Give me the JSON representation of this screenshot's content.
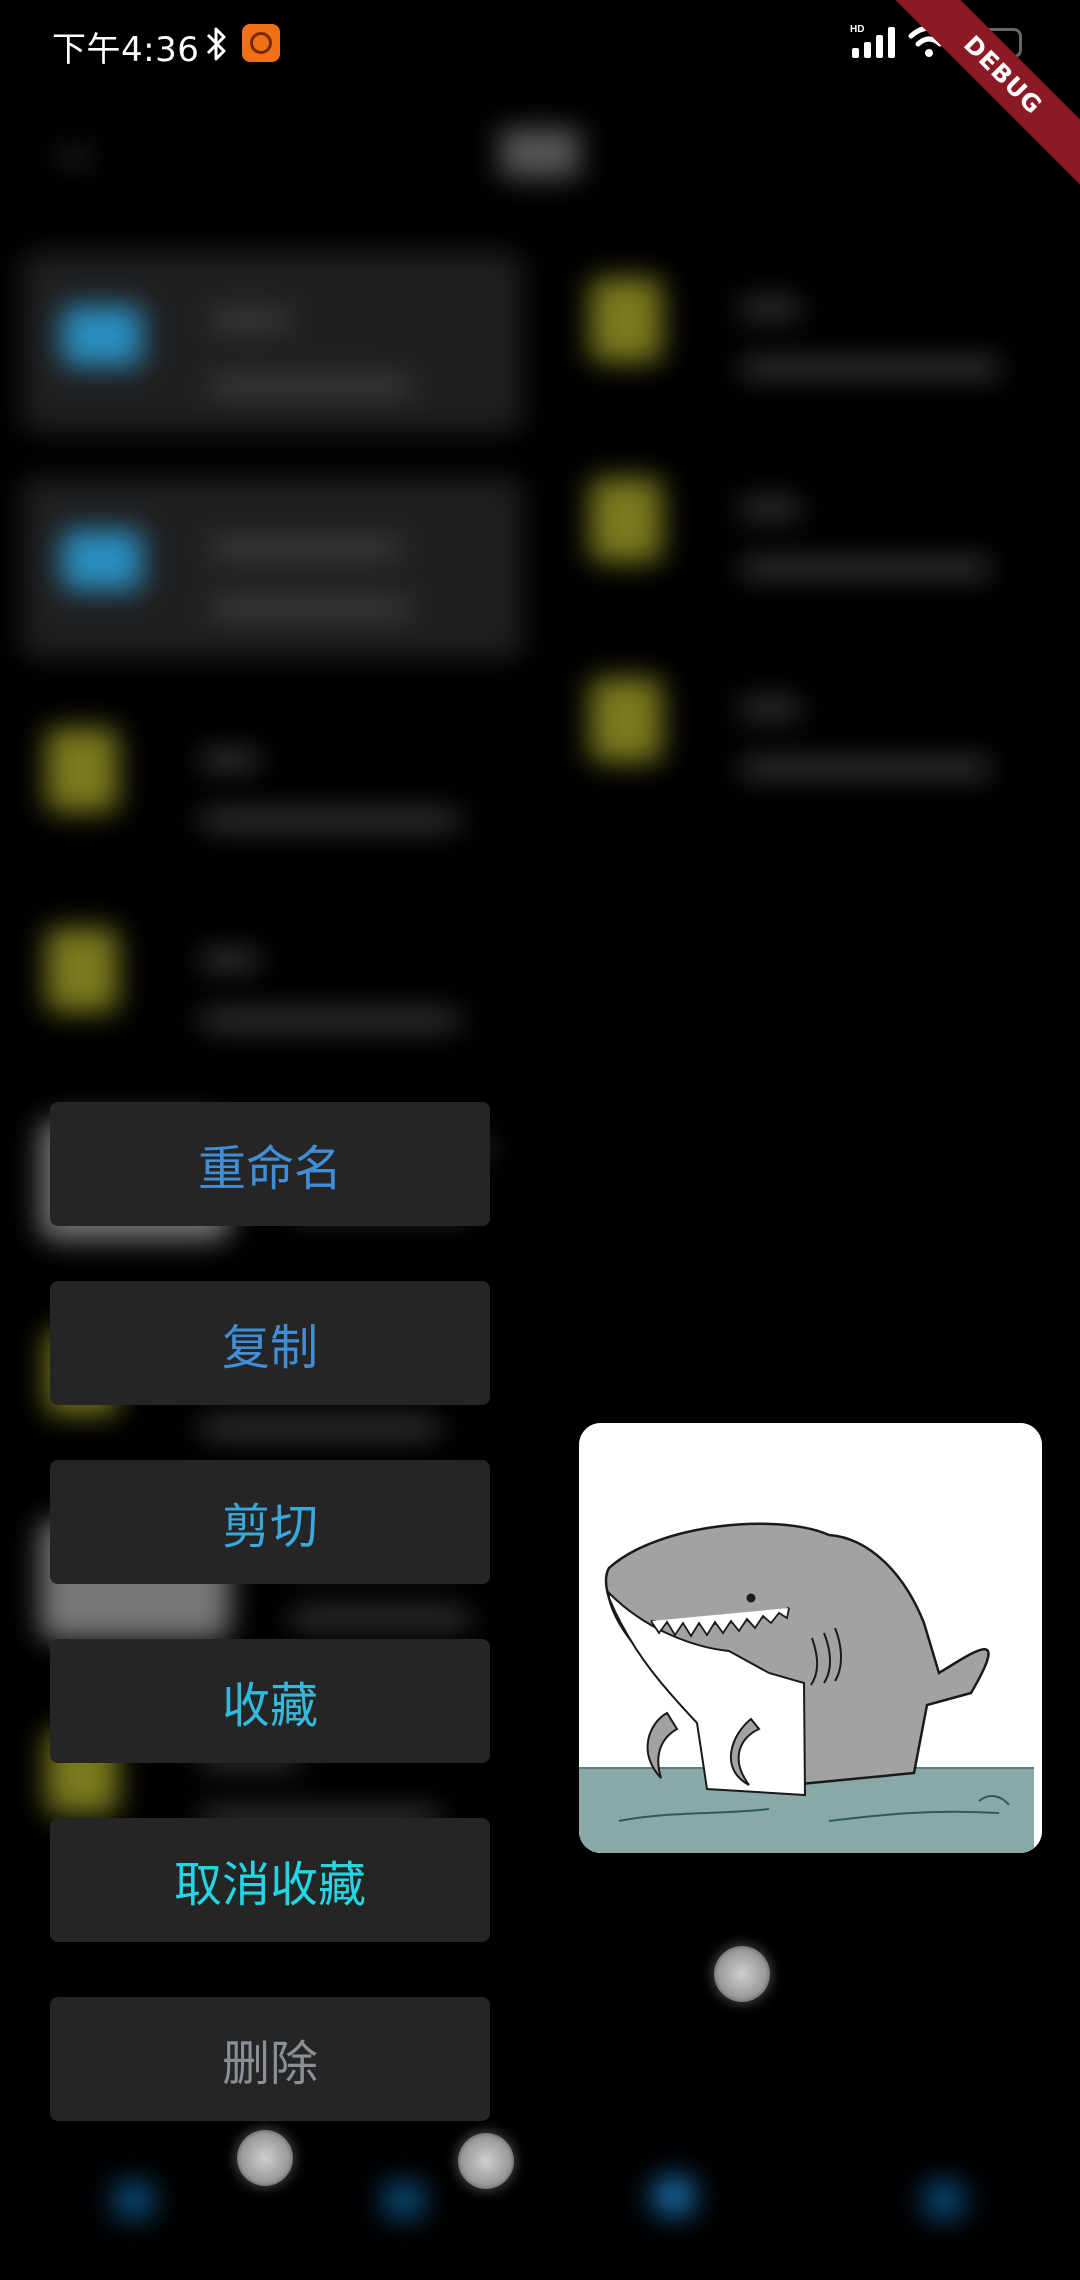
{
  "status_bar": {
    "time": "下午4:36",
    "network_label": "HD",
    "icons": [
      "bluetooth-icon",
      "app-badge-icon",
      "signal-icon",
      "wifi-icon",
      "battery-icon"
    ]
  },
  "debug_banner": "DEBUG",
  "context_menu": {
    "items": [
      {
        "label": "重命名",
        "color": "#3f8fd8"
      },
      {
        "label": "复制",
        "color": "#3f8fd8"
      },
      {
        "label": "剪切",
        "color": "#3aa8dc"
      },
      {
        "label": "收藏",
        "color": "#34b8dc"
      },
      {
        "label": "取消收藏",
        "color": "#22d6e4"
      },
      {
        "label": "删除",
        "color": "#8a8f96"
      }
    ]
  },
  "preview": {
    "subject": "shark illustration"
  },
  "colors": {
    "background": "#000000",
    "menu_bg": "#252525",
    "ribbon": "#8b1a24"
  }
}
